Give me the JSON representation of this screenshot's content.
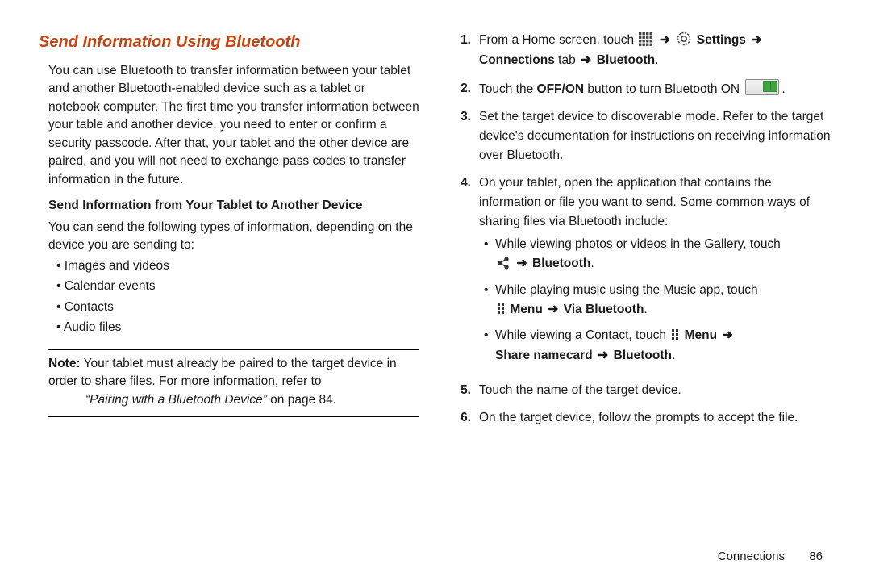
{
  "section_title": "Send Information Using Bluetooth",
  "intro": "You can use Bluetooth to transfer information between your tablet and another Bluetooth-enabled device such as a tablet or notebook computer. The first time you transfer information between your table and another device, you need to enter or confirm a security passcode. After that, your tablet and the other device are paired, and you will not need to exchange pass codes to transfer information in the future.",
  "sub_heading": "Send Information from Your Tablet to Another Device",
  "send_intro": "You can send the following types of information, depending on the device you are sending to:",
  "bullets": [
    "Images and videos",
    "Calendar events",
    "Contacts",
    "Audio files"
  ],
  "note_lead": "Note:",
  "note_body_1": " Your tablet must already be paired to the target device in order to share files. For more information, refer to ",
  "note_ref": "“Pairing with a Bluetooth Device”",
  "note_body_2": " on page 84.",
  "steps": {
    "s1_a": "From a Home screen, touch ",
    "s1_b": " Settings ",
    "s1_c": "Connections",
    "s1_d": " tab ",
    "s1_e": " Bluetooth",
    "s2_a": "Touch the ",
    "s2_b": "OFF/ON",
    "s2_c": " button to turn Bluetooth ON ",
    "s3": "Set the target device to discoverable mode. Refer to the target device's documentation for instructions on receiving information over Bluetooth.",
    "s4": "On your tablet, open the application that contains the information or file you want to send. Some common ways of sharing files via Bluetooth include:",
    "s4_b1_a": "While viewing photos or videos in the Gallery, touch ",
    "s4_b1_b": " Bluetooth",
    "s4_b2_a": "While playing music using the Music app, touch ",
    "s4_b2_b": " Menu ",
    "s4_b2_c": " Via Bluetooth",
    "s4_b3_a": "While viewing a Contact, touch ",
    "s4_b3_b": " Menu ",
    "s4_b3_c": "Share namecard ",
    "s4_b3_d": " Bluetooth",
    "s5": "Touch the name of the target device.",
    "s6": "On the target device, follow the prompts to accept the file."
  },
  "arrow": "➜",
  "footer_section": "Connections",
  "footer_page": "86"
}
